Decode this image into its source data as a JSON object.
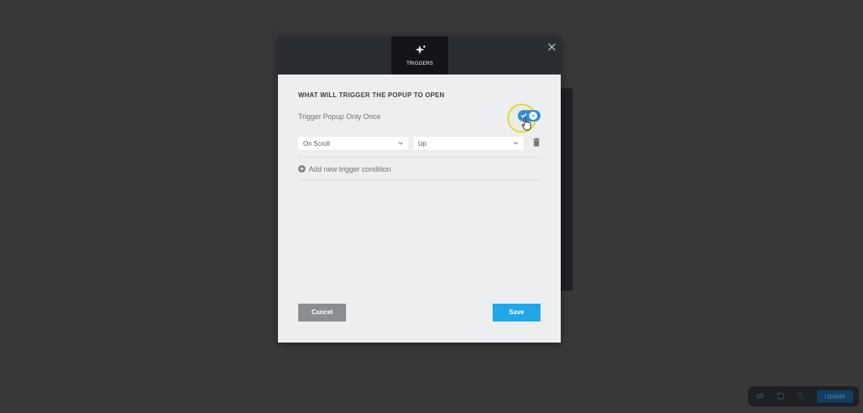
{
  "modal": {
    "tab_label": "TRIGGERS",
    "tab_icon": "sparkle-icon",
    "section_title": "WHAT WILL TRIGGER THE POPUP TO OPEN",
    "once_label": "Trigger Popup Only Once",
    "once_enabled": true,
    "condition": {
      "event_value": "On Scroll",
      "direction_value": "Up"
    },
    "add_condition_label": "Add new trigger condition",
    "cancel_label": "Cancel",
    "save_label": "Save"
  },
  "bottom_bar": {
    "update_label": "Update",
    "icons": [
      "eye-off-icon",
      "history-icon",
      "search-icon"
    ]
  },
  "colors": {
    "accent": "#21a6e8",
    "toggle": "#2f8fd6",
    "header": "#2a2d31",
    "highlight": "#e5d63a"
  }
}
